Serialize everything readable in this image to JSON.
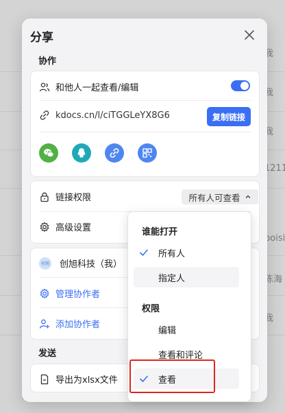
{
  "background": {
    "snippets": [
      "我",
      "我",
      "我",
      "1211",
      "poisi",
      "陈海",
      "我"
    ]
  },
  "dialog": {
    "title": "分享",
    "collab_section": "协作",
    "collab_toggle_label": "和他人一起查看/编辑",
    "collab_toggle_on": true,
    "link_text": "kdocs.cn/l/ciTGGLeYX8G6",
    "copy_link_label": "复制链接",
    "share_icons": [
      "wechat-icon",
      "qq-icon",
      "link-icon",
      "qrcode-icon"
    ],
    "link_permission_label": "链接权限",
    "link_permission_value": "所有人可查看",
    "advanced_label": "高级设置",
    "owner_avatar_text": "创旭",
    "owner_name": "创旭科技（我）",
    "manage_collab_label": "管理协作者",
    "add_collab_label": "添加协作者",
    "send_section": "发送",
    "export_label": "导出为xlsx文件"
  },
  "dropdown": {
    "who_can_open": "谁能打开",
    "who_options": [
      {
        "label": "所有人",
        "selected": true
      },
      {
        "label": "指定人",
        "selected": false
      }
    ],
    "permission_heading": "权限",
    "permission_options": [
      {
        "label": "编辑",
        "selected": false
      },
      {
        "label": "查看和评论",
        "selected": false
      },
      {
        "label": "查看",
        "selected": true
      }
    ]
  },
  "colors": {
    "accent": "#3a6ff3",
    "highlight_border": "#e0241d",
    "wechat": "#52b045",
    "qq": "#1fa9b8"
  }
}
